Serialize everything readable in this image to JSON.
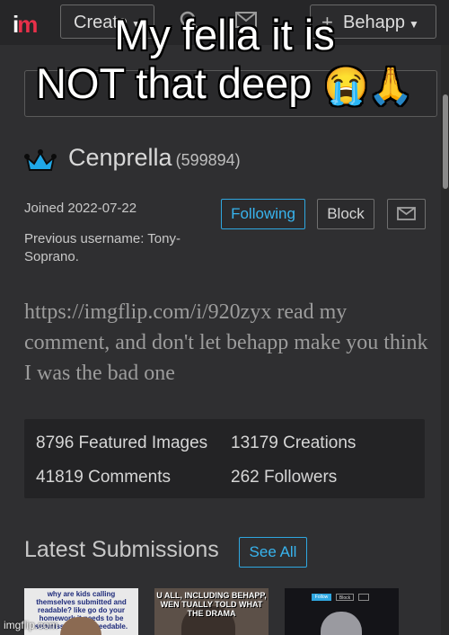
{
  "caption": {
    "line1": "My fella it is",
    "line2": "NOT that deep",
    "emojis": "😭🙏"
  },
  "nav": {
    "logo_i": "i",
    "logo_m": "m",
    "create_label": "Create",
    "user_label": "Behapp",
    "icons": [
      "search-icon",
      "mail-icon",
      "plus-icon",
      "caret-down-icon"
    ]
  },
  "profile": {
    "username": "Cenprella",
    "user_id": "(599894)",
    "joined": "Joined 2022-07-22",
    "previous_username": "Previous username: Tony-Soprano.",
    "following_label": "Following",
    "block_label": "Block",
    "bio": "https://imgflip.com/i/920zyx read my comment, and don't let behapp make you think I was the bad one",
    "crown_icon": "crown-icon",
    "accent_color": "#2fa7e0"
  },
  "stats": {
    "featured": "8796 Featured Images",
    "creations": "13179 Creations",
    "comments": "41819 Comments",
    "followers": "262 Followers"
  },
  "latest": {
    "title": "Latest Submissions",
    "see_all_label": "See All",
    "thumbs": [
      {
        "text": "why are kids calling themselves submitted and readable? like go do your homework it needs to be submission and breedable."
      },
      {
        "text": "U ALL, INCLUDING BEHAPP, WEN TUALLY TOLD WHAT THE DRAMA"
      },
      {
        "follow_label": "Follow",
        "block_label": "Block"
      }
    ]
  },
  "watermark": "imgflip.com"
}
